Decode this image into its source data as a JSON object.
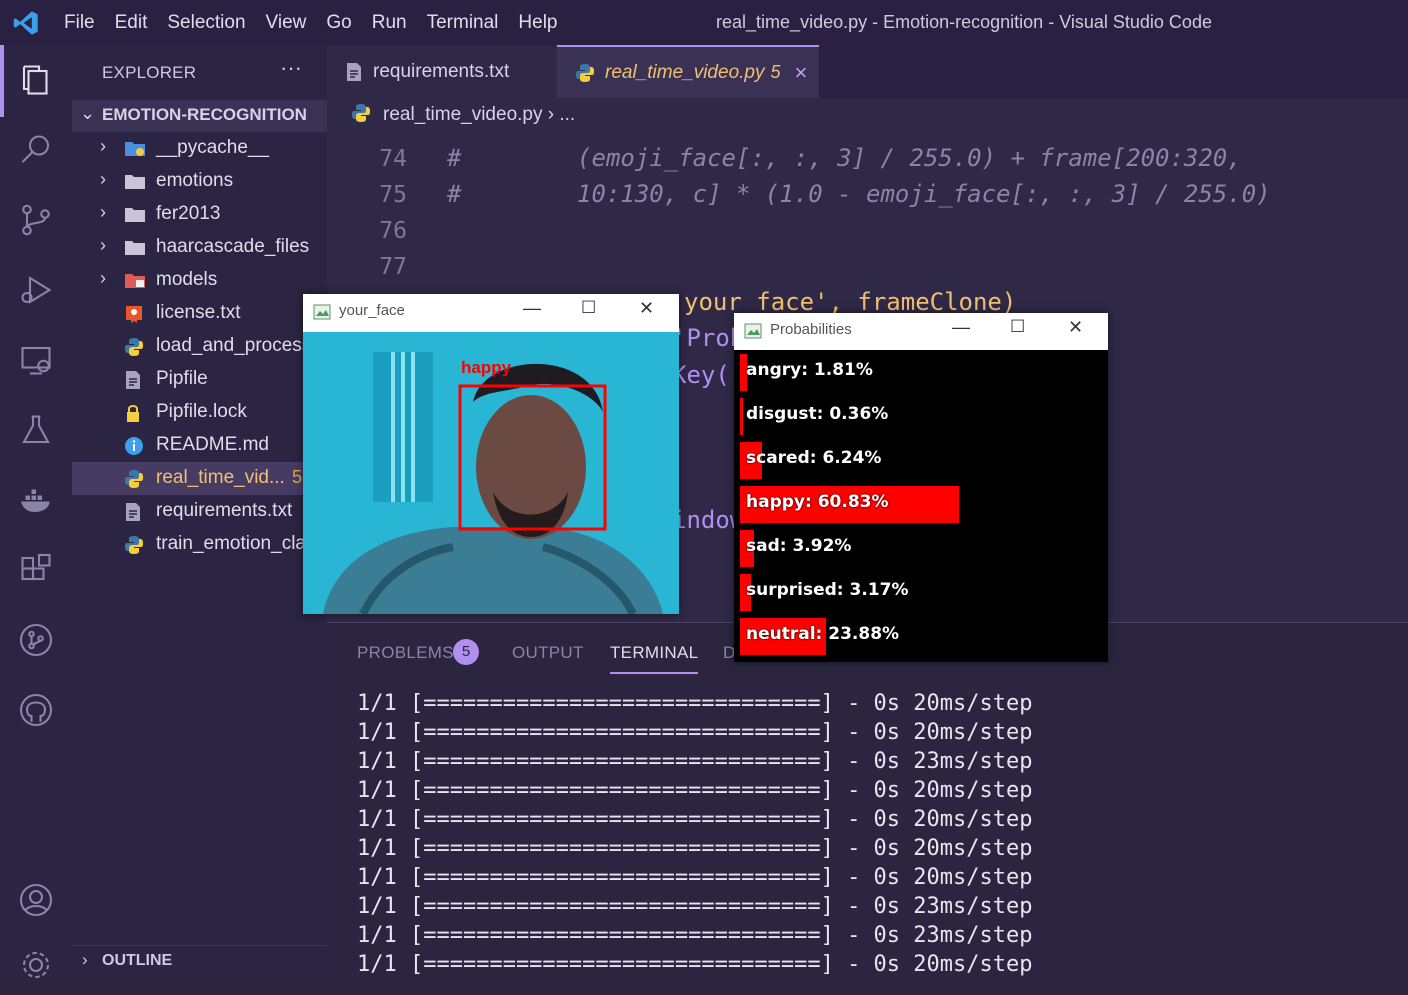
{
  "titlebar": {
    "menu": [
      "File",
      "Edit",
      "Selection",
      "View",
      "Go",
      "Run",
      "Terminal",
      "Help"
    ],
    "window_title": "real_time_video.py - Emotion-recognition - Visual Studio Code"
  },
  "sidebar": {
    "header": "EXPLORER",
    "more": "···",
    "folder": "EMOTION-RECOGNITION",
    "items": [
      {
        "label": "__pycache__",
        "kind": "folder",
        "icon": "folder-blue-icon"
      },
      {
        "label": "emotions",
        "kind": "folder",
        "icon": "folder-icon"
      },
      {
        "label": "fer2013",
        "kind": "folder",
        "icon": "folder-icon"
      },
      {
        "label": "haarcascade_files",
        "kind": "folder",
        "icon": "folder-icon"
      },
      {
        "label": "models",
        "kind": "folder",
        "icon": "folder-red-icon"
      },
      {
        "label": "license.txt",
        "kind": "file",
        "icon": "license-icon"
      },
      {
        "label": "load_and_process.py",
        "kind": "file",
        "icon": "python-icon"
      },
      {
        "label": "Pipfile",
        "kind": "file",
        "icon": "file-icon"
      },
      {
        "label": "Pipfile.lock",
        "kind": "file",
        "icon": "lock-icon"
      },
      {
        "label": "README.md",
        "kind": "file",
        "icon": "info-icon"
      },
      {
        "label": "real_time_vid...",
        "kind": "file",
        "icon": "python-icon",
        "badge": "5",
        "selected": true
      },
      {
        "label": "requirements.txt",
        "kind": "file",
        "icon": "file-icon"
      },
      {
        "label": "train_emotion_classifier.py",
        "kind": "file",
        "icon": "python-icon"
      }
    ],
    "outline": "OUTLINE"
  },
  "tabs": [
    {
      "label": "requirements.txt"
    },
    {
      "label": "real_time_video.py",
      "count": "5",
      "close": "×"
    }
  ],
  "breadcrumb": {
    "file": "real_time_video.py",
    "sep": "›",
    "rest": "..."
  },
  "editor": {
    "lines": [
      {
        "num": "74",
        "code": "#        (emoji_face[:, :, 3] / 255.0) + frame[200:320,"
      },
      {
        "num": "75",
        "code": "#        10:130, c] * (1.0 - emoji_face[:, :, 3] / 255.0)"
      },
      {
        "num": "76",
        "code": ""
      },
      {
        "num": "77",
        "code": ""
      }
    ],
    "partial": [
      "your_face', frameClone)",
      "'Prob",
      "Key(",
      ")",
      "indow"
    ]
  },
  "panel": {
    "tabs": [
      "PROBLEMS",
      "OUTPUT",
      "TERMINAL",
      "D"
    ],
    "problems_count": "5",
    "terminal_lines": [
      "1/1 [==============================] - 0s 20ms/step",
      "1/1 [==============================] - 0s 20ms/step",
      "1/1 [==============================] - 0s 23ms/step",
      "1/1 [==============================] - 0s 20ms/step",
      "1/1 [==============================] - 0s 20ms/step",
      "1/1 [==============================] - 0s 20ms/step",
      "1/1 [==============================] - 0s 20ms/step",
      "1/1 [==============================] - 0s 23ms/step",
      "1/1 [==============================] - 0s 23ms/step",
      "1/1 [==============================] - 0s 20ms/step"
    ]
  },
  "face_window": {
    "title": "your_face",
    "label": "happy"
  },
  "prob_window": {
    "title": "Probabilities",
    "rows": [
      {
        "text": "angry: 1.81%",
        "fraction": 0.0181
      },
      {
        "text": "disgust: 0.36%",
        "fraction": 0.0036
      },
      {
        "text": "scared: 6.24%",
        "fraction": 0.0624
      },
      {
        "text": "happy: 60.83%",
        "fraction": 0.6083
      },
      {
        "text": "sad: 3.92%",
        "fraction": 0.0392
      },
      {
        "text": "surprised: 3.17%",
        "fraction": 0.0317
      },
      {
        "text": "neutral: 23.88%",
        "fraction": 0.2388
      }
    ]
  },
  "colors": {
    "accent": "#b18ff0",
    "bar": "#ff0000",
    "selected_file": "#f0c070"
  }
}
